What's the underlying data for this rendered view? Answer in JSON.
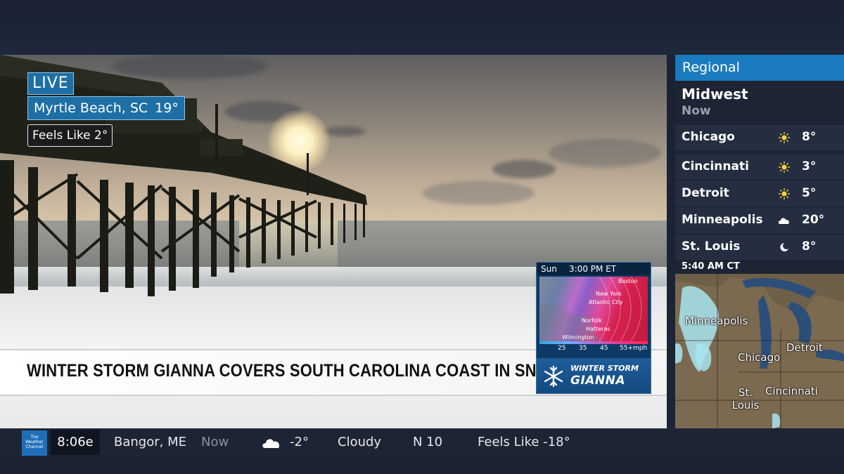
{
  "live": {
    "badge": "LIVE",
    "location": "Myrtle Beach, SC",
    "temp": "19°",
    "feels_like": "Feels Like 2°"
  },
  "headline": "WINTER STORM GIANNA COVERS SOUTH CAROLINA COAST IN SNOW",
  "storm_card": {
    "day": "Sun",
    "time": "3:00 PM ET",
    "map_labels": [
      "Boston",
      "New York",
      "Atlantic City",
      "Norfolk",
      "Hatteras",
      "Wilmington"
    ],
    "scale": [
      "25",
      "35",
      "45",
      "55+mph"
    ],
    "title_line1": "WINTER STORM",
    "title_line2": "GIANNA"
  },
  "regional": {
    "header": "Regional",
    "region": "Midwest",
    "now": "Now",
    "cities": [
      {
        "name": "Chicago",
        "icon": "sun-icon",
        "temp": "8°"
      },
      {
        "name": "Cincinnati",
        "icon": "sun-icon",
        "temp": "3°"
      },
      {
        "name": "Detroit",
        "icon": "sun-icon",
        "temp": "5°"
      },
      {
        "name": "Minneapolis",
        "icon": "cloud-icon",
        "temp": "20°"
      },
      {
        "name": "St. Louis",
        "icon": "moon-icon",
        "temp": "8°"
      }
    ],
    "radar_time": "5:40 AM CT",
    "radar_labels": [
      "Minneapolis",
      "Chicago",
      "Detroit",
      "St. Louis",
      "Cincinnati"
    ]
  },
  "ticker": {
    "logo_text": [
      "The",
      "Weather",
      "Channel"
    ],
    "time": "8:06e",
    "city": "Bangor, ME",
    "now": "Now",
    "temp": "-2°",
    "condition": "Cloudy",
    "wind": "N 10",
    "feels": "Feels Like -18°"
  },
  "colors": {
    "accent_blue": "#1a7bbf",
    "panel_dark": "#1d2535"
  }
}
